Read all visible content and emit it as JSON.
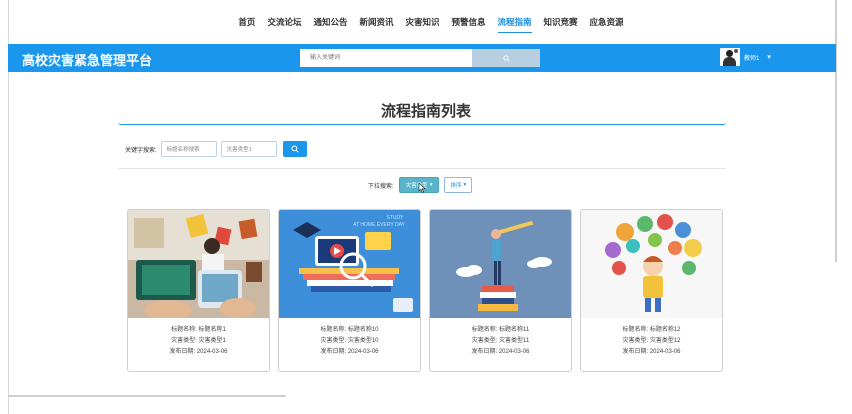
{
  "nav": {
    "items": [
      {
        "label": "首页",
        "active": false
      },
      {
        "label": "交流论坛",
        "active": false
      },
      {
        "label": "通知公告",
        "active": false
      },
      {
        "label": "新闻资讯",
        "active": false
      },
      {
        "label": "灾害知识",
        "active": false
      },
      {
        "label": "预警信息",
        "active": false
      },
      {
        "label": "流程指南",
        "active": true
      },
      {
        "label": "知识竞赛",
        "active": false
      },
      {
        "label": "应急资源",
        "active": false
      }
    ]
  },
  "header": {
    "brand": "高校灾害紧急管理平台",
    "search_placeholder": "输入关键词",
    "user_name": "教师1",
    "user_caret": "▾",
    "accent": "#1a97ec"
  },
  "page": {
    "title": "流程指南列表"
  },
  "filters": {
    "label": "关键字搜索:",
    "title_placeholder": "标题名称搜索",
    "type_value": "灾害类型1",
    "dropdown_label": "下拉搜索:",
    "dropdown_primary": "灾害类型",
    "dropdown_secondary": "排序"
  },
  "cards": [
    {
      "title_label": "标题名称:",
      "title": "标题名称1",
      "type_label": "灾害类型:",
      "type": "灾害类型1",
      "date_label": "发布日期:",
      "date": "2024-03-06"
    },
    {
      "title_label": "标题名称:",
      "title": "标题名称10",
      "type_label": "灾害类型:",
      "type": "灾害类型10",
      "date_label": "发布日期:",
      "date": "2024-03-06"
    },
    {
      "title_label": "标题名称:",
      "title": "标题名称11",
      "type_label": "灾害类型:",
      "type": "灾害类型11",
      "date_label": "发布日期:",
      "date": "2024-03-06"
    },
    {
      "title_label": "标题名称:",
      "title": "标题名称12",
      "type_label": "灾害类型:",
      "type": "灾害类型12",
      "date_label": "发布日期:",
      "date": "2024-03-06"
    }
  ],
  "card2_overlay": {
    "line1": "STUDY",
    "line2": "AT HOME EVERY DAY"
  }
}
